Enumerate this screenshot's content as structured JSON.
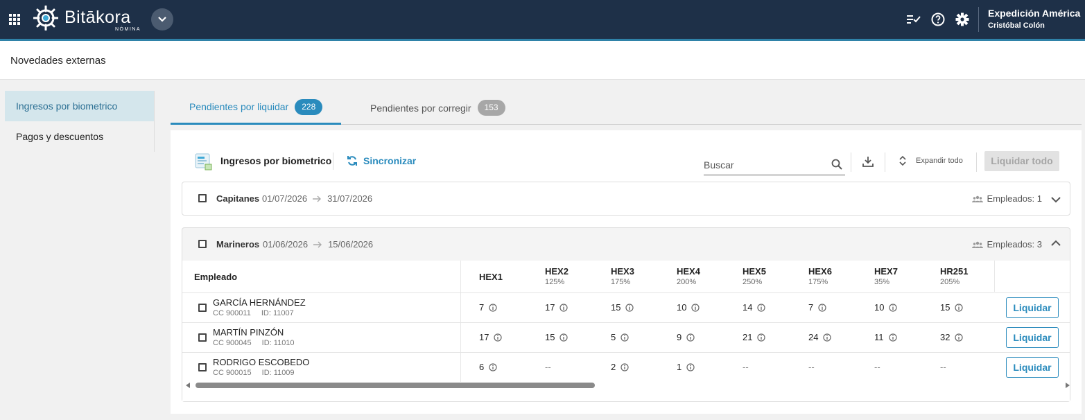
{
  "app": {
    "brand": "Bitākora",
    "brand_sub": "NÓMINA",
    "company": "Expedición América",
    "user": "Cristóbal Colón"
  },
  "page": {
    "title": "Novedades externas"
  },
  "sidebar": {
    "items": [
      {
        "label": "Ingresos por biometrico",
        "active": true
      },
      {
        "label": "Pagos y descuentos",
        "active": false
      }
    ]
  },
  "tabs": [
    {
      "label": "Pendientes por liquidar",
      "count": "228",
      "color": "#2a8bbd",
      "active": true
    },
    {
      "label": "Pendientes por corregir",
      "count": "153",
      "color": "#a7a7a7",
      "active": false
    }
  ],
  "toolbar": {
    "title": "Ingresos por biometrico",
    "sync_label": "Sincronizar",
    "search_placeholder": "Buscar",
    "expand_label": "Expandir todo",
    "liquidar_todo": "Liquidar todo"
  },
  "groups": [
    {
      "name": "Capitanes",
      "start": "01/07/2026",
      "end": "31/07/2026",
      "employees": "Empleados: 1",
      "expanded": false
    },
    {
      "name": "Marineros",
      "start": "01/06/2026",
      "end": "15/06/2026",
      "employees": "Empleados: 3",
      "expanded": true
    }
  ],
  "table": {
    "employee_header": "Empleado",
    "columns": [
      {
        "code": "HEX1",
        "pct": ""
      },
      {
        "code": "HEX2",
        "pct": "125%"
      },
      {
        "code": "HEX3",
        "pct": "175%"
      },
      {
        "code": "HEX4",
        "pct": "200%"
      },
      {
        "code": "HEX5",
        "pct": "250%"
      },
      {
        "code": "HEX6",
        "pct": "175%"
      },
      {
        "code": "HEX7",
        "pct": "35%"
      },
      {
        "code": "HR251",
        "pct": "205%"
      }
    ],
    "rows": [
      {
        "name": "GARCÍA HERNÁNDEZ",
        "cc": "CC 900011",
        "id": "ID: 11007",
        "values": [
          "7",
          "17",
          "15",
          "10",
          "14",
          "7",
          "10",
          "15"
        ]
      },
      {
        "name": "MARTÍN PINZÓN",
        "cc": "CC 900045",
        "id": "ID: 11010",
        "values": [
          "17",
          "15",
          "5",
          "9",
          "21",
          "24",
          "11",
          "32"
        ]
      },
      {
        "name": "RODRIGO ESCOBEDO",
        "cc": "CC 900015",
        "id": "ID: 11009",
        "values": [
          "6",
          "--",
          "2",
          "1",
          "--",
          "--",
          "--",
          "--"
        ]
      }
    ],
    "action_label": "Liquidar"
  }
}
